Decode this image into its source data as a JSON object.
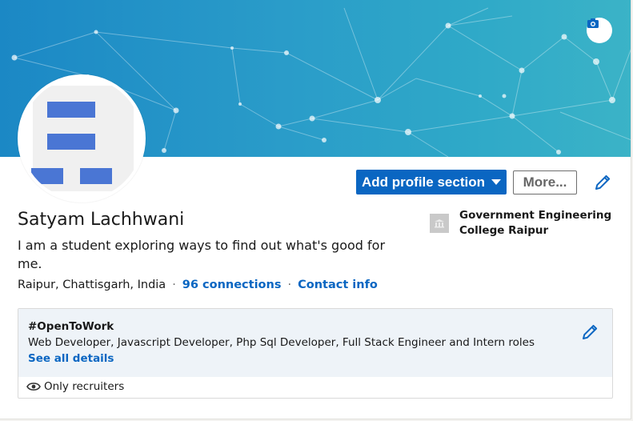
{
  "profile": {
    "name": "Satyam Lachhwani",
    "headline": "I am a student exploring ways to find out what's good for me.",
    "location": "Raipur, Chattisgarh, India",
    "separator": "·",
    "connections": "96 connections",
    "contact_info": "Contact info"
  },
  "actions": {
    "add_profile_section": "Add profile section",
    "more": "More..."
  },
  "education": {
    "name": "Government Engineering College Raipur"
  },
  "open_to_work": {
    "title": "#OpenToWork",
    "roles": "Web Developer, Javascript Developer, Php Sql Developer, Full Stack Engineer and Intern roles",
    "see_all": "See all details",
    "visibility": "Only recruiters"
  },
  "icons": {
    "camera": "camera-icon",
    "pencil": "pencil-icon",
    "eye": "eye-icon",
    "school": "school-icon",
    "caret": "caret-down-icon"
  },
  "colors": {
    "primary": "#0a66c2",
    "banner": "#1b88c5",
    "avatar_bars": "#4a76d4",
    "otw_bg": "#eef3f8"
  }
}
